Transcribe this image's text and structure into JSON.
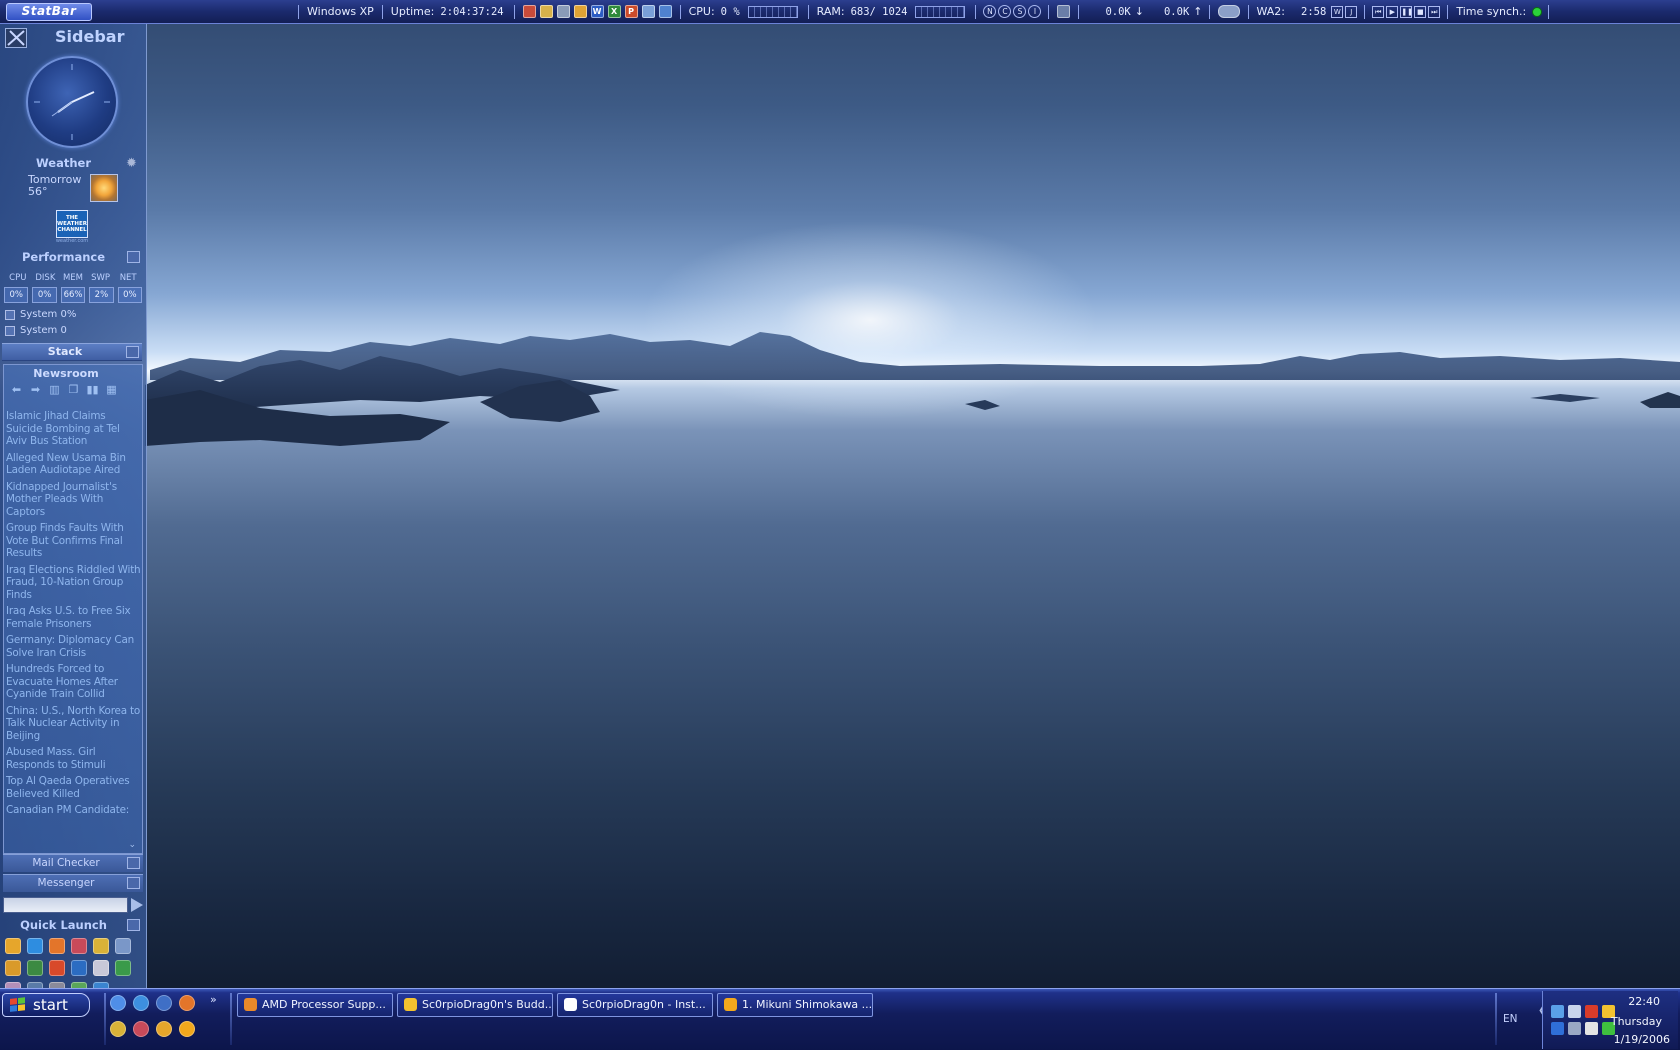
{
  "statbar": {
    "logo": "StatBar",
    "os": "Windows XP",
    "uptime_label": "Uptime:",
    "uptime_value": "2:04:37:24",
    "cpu_label": "CPU:",
    "cpu_value": "0 %",
    "ram_label": "RAM:",
    "ram_value": "683/ 1024",
    "net_down": "0.0K",
    "net_up": "0.0K",
    "wa2_label": "WA2:",
    "wa2_time": "2:58",
    "wa2_w": "W",
    "wa2_j": "J",
    "time_sync_label": "Time synch.:",
    "status_color": "#2bd23a",
    "ncsi": [
      "N",
      "C",
      "S",
      "I"
    ]
  },
  "sidebar": {
    "title": "Sidebar",
    "weather": {
      "title": "Weather",
      "day": "Tomorrow",
      "temp": "56°",
      "icon": "sunny-icon",
      "channel_logo": "THE WEATHER CHANNEL",
      "channel_url": "weather.com"
    },
    "performance": {
      "title": "Performance",
      "labels": [
        "CPU",
        "DISK",
        "MEM",
        "SWP",
        "NET"
      ],
      "values": [
        "0%",
        "0%",
        "66%",
        "2%",
        "0%"
      ],
      "system_1": "System 0%",
      "system_2": "System 0"
    },
    "stack": {
      "title": "Stack"
    },
    "newsroom": {
      "title": "Newsroom",
      "items": [
        "Islamic Jihad Claims Suicide Bombing at Tel Aviv Bus Station",
        "Alleged New Usama Bin Laden Audiotape Aired",
        "Kidnapped Journalist's Mother Pleads With Captors",
        "Group Finds Faults With Vote But Confirms Final Results",
        "Iraq Elections Riddled With Fraud, 10-Nation Group Finds",
        "Iraq Asks U.S. to Free Six Female Prisoners",
        "Germany: Diplomacy Can Solve Iran Crisis",
        "Hundreds Forced to Evacuate Homes After Cyanide Train Collid",
        "China: U.S., North Korea to Talk Nuclear Activity in Beijing",
        "Abused Mass. Girl Responds to Stimuli",
        "Top Al Qaeda Operatives Believed Killed",
        "Canadian PM Candidate:"
      ]
    },
    "mail_checker": "Mail Checker",
    "messenger": "Messenger",
    "quick_launch": {
      "title": "Quick Launch"
    }
  },
  "taskbar": {
    "start": "start",
    "quicklaunch_more": "»",
    "tasks": [
      {
        "label": "AMD Processor Supp...",
        "color": "#e8892a"
      },
      {
        "label": "Sc0rpioDrag0n's Budd...",
        "color": "#f2c230"
      },
      {
        "label": "Sc0rpioDrag0n - Inst...",
        "color": "#ffffff"
      },
      {
        "label": "1. Mikuni Shimokawa ...",
        "color": "#f2a81c"
      }
    ],
    "language": "EN",
    "clock_time": "22:40",
    "clock_day": "Thursday",
    "clock_date": "1/19/2006"
  },
  "colors": {
    "statbar_bg": "#1b2a6d",
    "taskbar_bg": "#121d5c",
    "sidebar_bg": "#2e4c88",
    "news_link": "#8fb6ee"
  }
}
